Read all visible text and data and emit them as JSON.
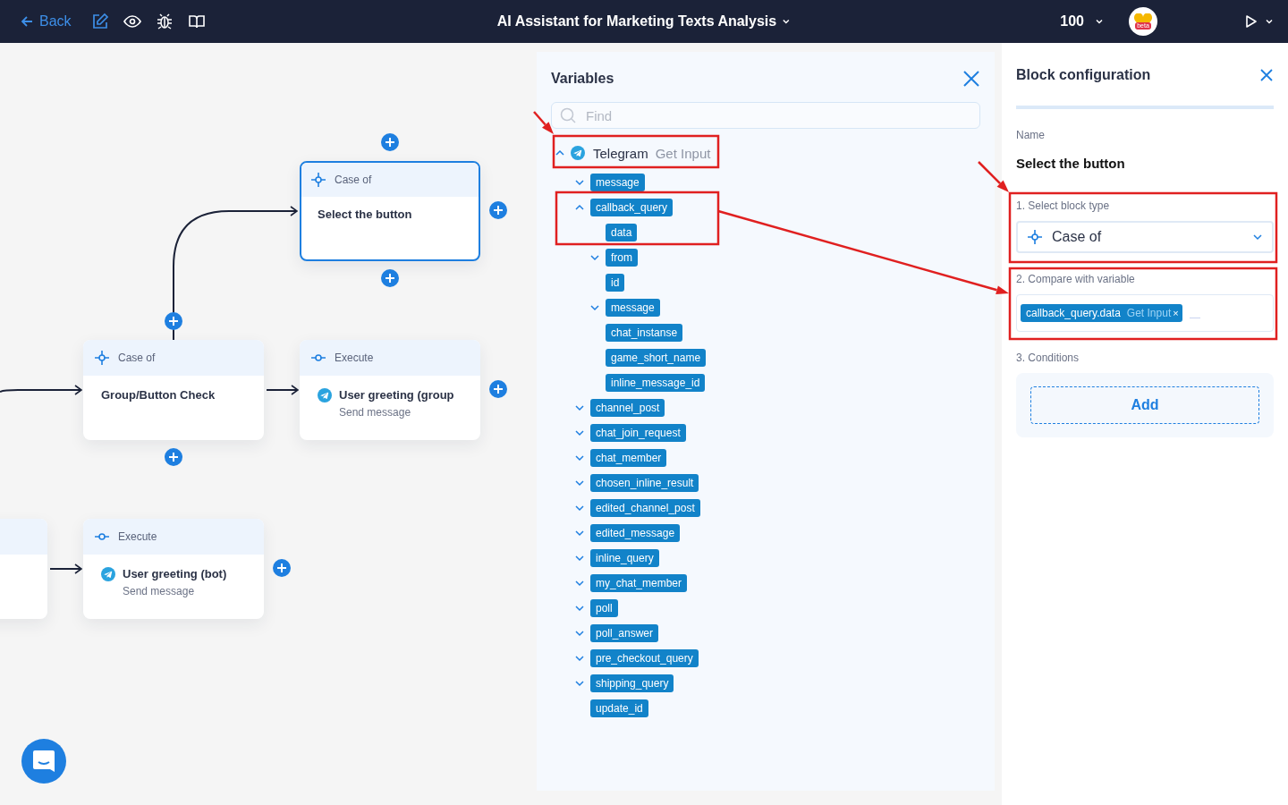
{
  "topbar": {
    "back": "Back",
    "title": "AI Assistant for Marketing Texts Analysis",
    "zoom": "100",
    "logo_badge": "beta"
  },
  "canvas": {
    "nodes": [
      {
        "kind": "case",
        "type_label": "Case of",
        "title": "Select the button",
        "selected": true
      },
      {
        "kind": "case",
        "type_label": "Case of",
        "title": "Group/Button Check",
        "selected": false
      },
      {
        "kind": "execute",
        "type_label": "Execute",
        "title": "User greeting (group",
        "subtitle": "Send message",
        "selected": false
      },
      {
        "kind": "execute",
        "type_label": "Execute",
        "title": "User greeting (bot)",
        "subtitle": "Send message",
        "selected": false
      }
    ]
  },
  "variables": {
    "title": "Variables",
    "search": {
      "placeholder": "Find"
    },
    "tree": [
      {
        "label": "Telegram",
        "source": "Get Input",
        "expanded": true,
        "children": [
          {
            "label": "message",
            "expanded": false
          },
          {
            "label": "callback_query",
            "expanded": true,
            "children": [
              {
                "label": "data"
              },
              {
                "label": "from",
                "expanded": false
              },
              {
                "label": "id"
              },
              {
                "label": "message",
                "expanded": false
              },
              {
                "label": "chat_instanse"
              },
              {
                "label": "game_short_name"
              },
              {
                "label": "inline_message_id"
              }
            ]
          },
          {
            "label": "channel_post",
            "expanded": false
          },
          {
            "label": "chat_join_request",
            "expanded": false
          },
          {
            "label": "chat_member",
            "expanded": false
          },
          {
            "label": "chosen_inline_result",
            "expanded": false
          },
          {
            "label": "edited_channel_post",
            "expanded": false
          },
          {
            "label": "edited_message",
            "expanded": false
          },
          {
            "label": "inline_query",
            "expanded": false
          },
          {
            "label": "my_chat_member",
            "expanded": false
          },
          {
            "label": "poll",
            "expanded": false
          },
          {
            "label": "poll_answer",
            "expanded": false
          },
          {
            "label": "pre_checkout_query",
            "expanded": false
          },
          {
            "label": "shipping_query",
            "expanded": false
          },
          {
            "label": "update_id"
          }
        ]
      }
    ]
  },
  "config": {
    "title": "Block configuration",
    "name_label": "Name",
    "name_value": "Select the button",
    "block_type": {
      "label": "1. Select block type",
      "value": "Case of"
    },
    "compare": {
      "label": "2. Compare with variable",
      "chips": [
        {
          "variable": "callback_query.data",
          "source": "Get Input",
          "remove": "×"
        }
      ]
    },
    "conditions": {
      "label": "3. Conditions",
      "add_button": "Add"
    }
  }
}
